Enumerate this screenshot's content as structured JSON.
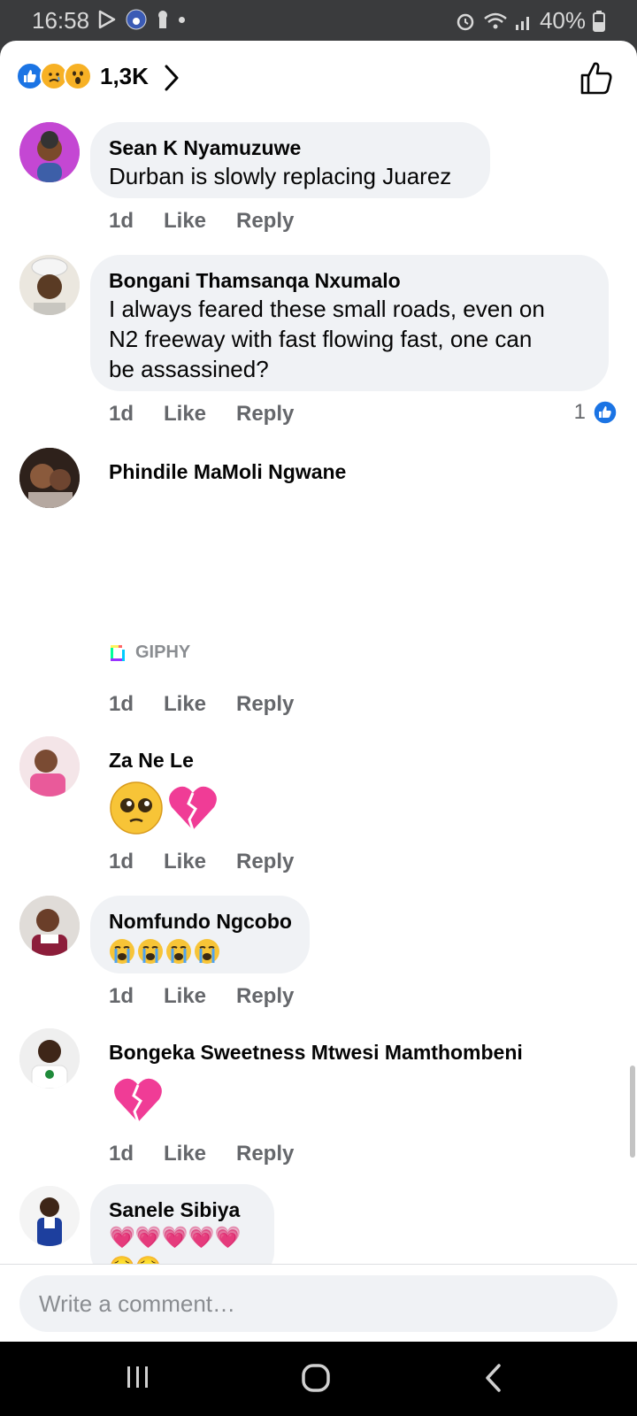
{
  "status_bar": {
    "time": "16:58",
    "battery": "40%"
  },
  "header": {
    "reaction_count": "1,3K"
  },
  "comments": [
    {
      "author": "Sean K Nyamuzuwe",
      "text": "Durban is slowly replacing Juarez",
      "time": "1d",
      "like": "Like",
      "reply": "Reply"
    },
    {
      "author": "Bongani Thamsanqa Nxumalo",
      "text_lines": [
        "I always feared these small roads, even on",
        "N2 freeway with fast flowing fast, one can",
        "be assassined?"
      ],
      "time": "1d",
      "like": "Like",
      "reply": "Reply",
      "like_count": "1"
    },
    {
      "author": "Phindile MaMoli Ngwane",
      "attachment": "GIPHY",
      "time": "1d",
      "like": "Like",
      "reply": "Reply"
    },
    {
      "author": "Za Ne Le",
      "emoji": "🥺💔",
      "time": "1d",
      "like": "Like",
      "reply": "Reply"
    },
    {
      "author": "Nomfundo Ngcobo",
      "emoji": "😭😭😭😭",
      "time": "1d",
      "like": "Like",
      "reply": "Reply"
    },
    {
      "author": "Bongeka Sweetness Mtwesi Mamthombeni",
      "emoji": "💔",
      "time": "1d",
      "like": "Like",
      "reply": "Reply"
    },
    {
      "author": "Sanele Sibiya",
      "emoji": "💗💗💗💗💗🥺🥺"
    }
  ],
  "composer": {
    "placeholder": "Write a comment…"
  },
  "colors": {
    "accent": "#1b74e4",
    "bubble": "#f0f2f5",
    "meta": "#65676b"
  }
}
